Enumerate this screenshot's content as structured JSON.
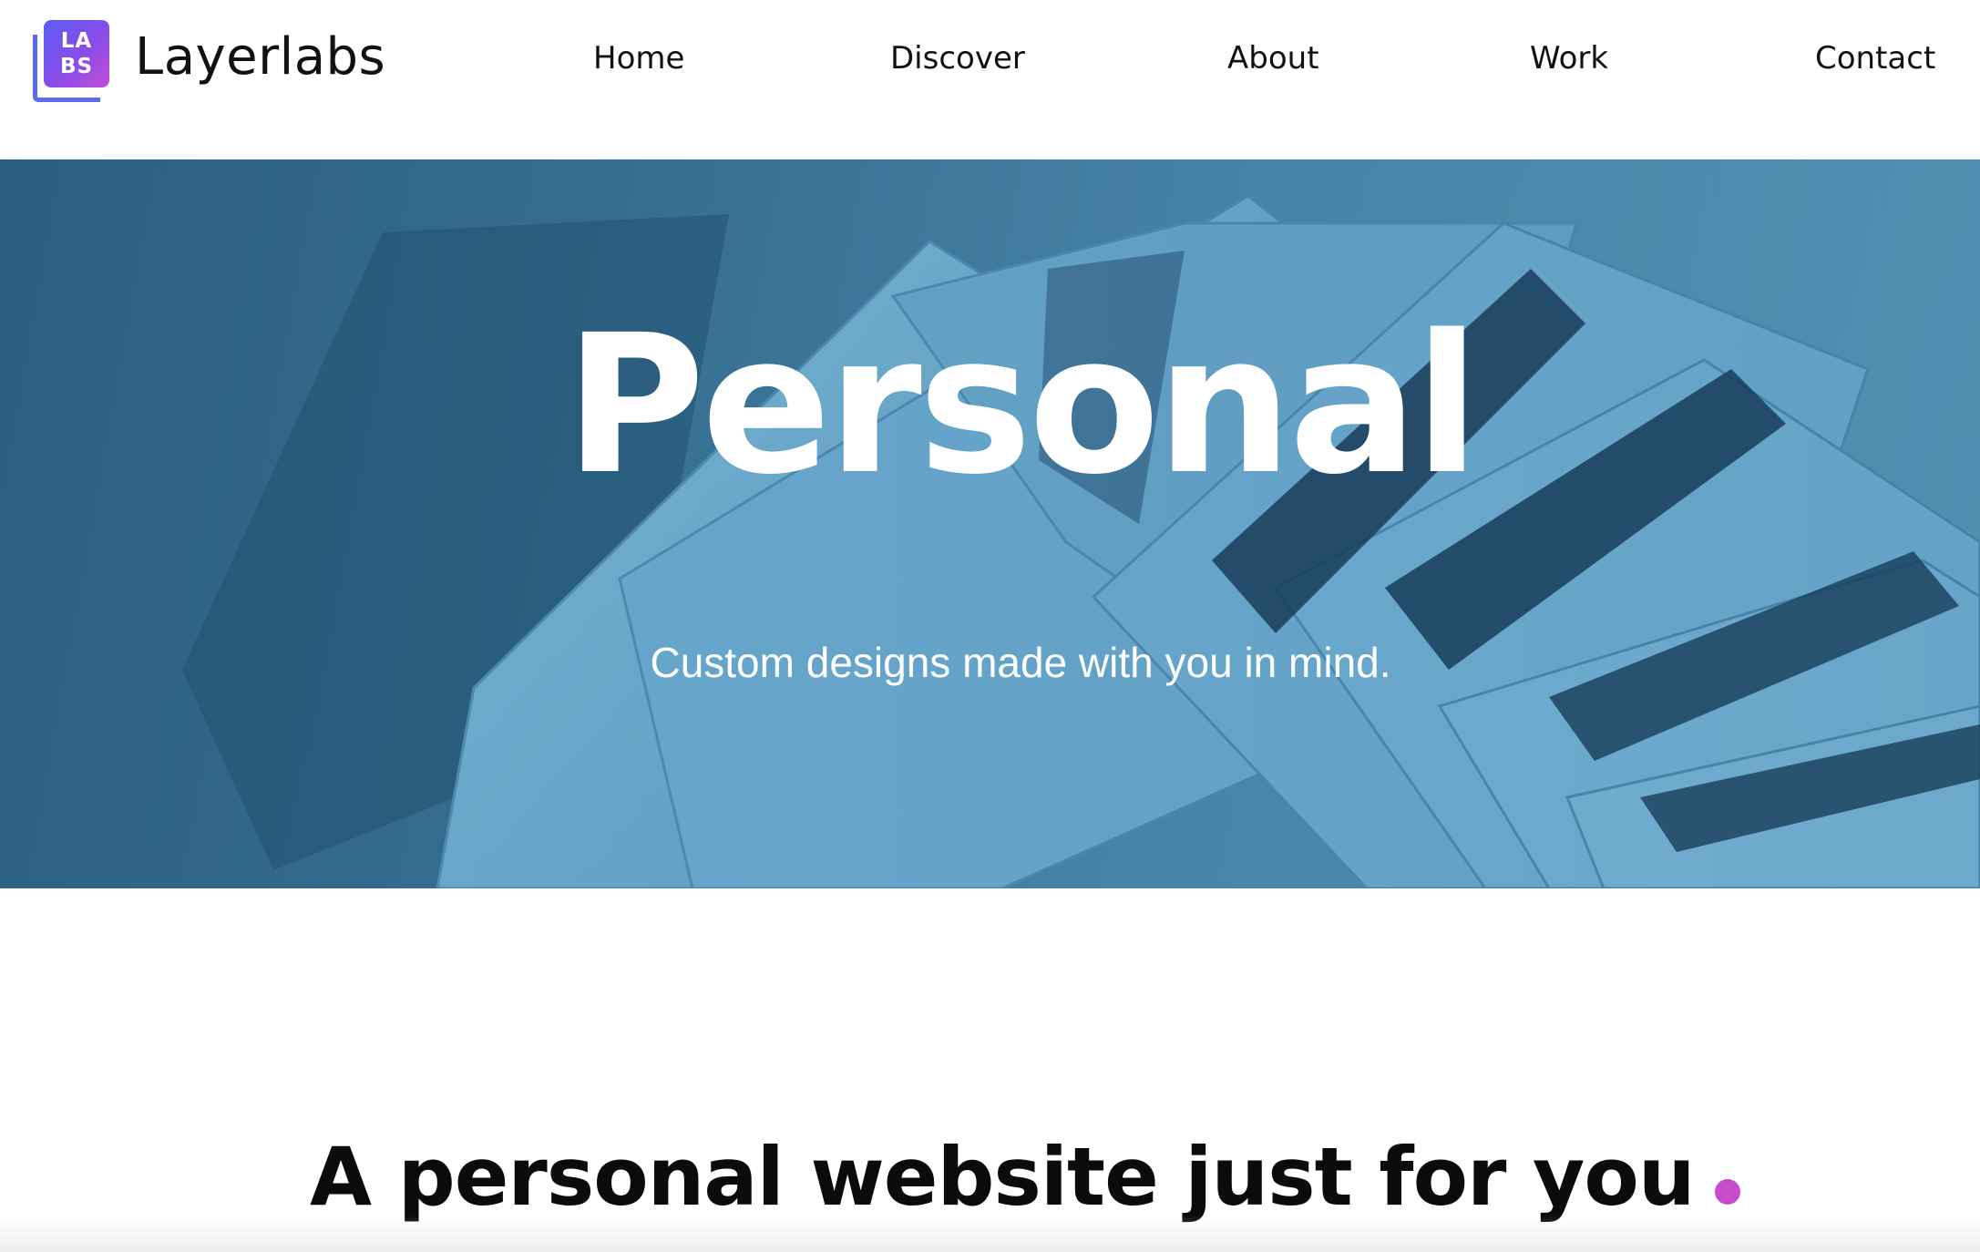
{
  "brand": {
    "logo_line1": "LA",
    "logo_line2": "BS",
    "name": "Layerlabs"
  },
  "nav": {
    "items": [
      {
        "label": "Home"
      },
      {
        "label": "Discover"
      },
      {
        "label": "About"
      },
      {
        "label": "Work"
      },
      {
        "label": "Contact"
      }
    ]
  },
  "hero": {
    "title": "Personal",
    "subtitle": "Custom designs made with you in mind."
  },
  "section": {
    "heading": "A personal website just for you"
  },
  "colors": {
    "accent": "#c64ccb",
    "logo_gradient_start": "#5a5cf5",
    "logo_gradient_end": "#c34bd6",
    "hero_bg": "#356f92",
    "panel": "#6aa9cc"
  }
}
